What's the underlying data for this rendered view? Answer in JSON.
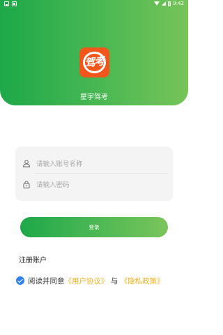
{
  "status_bar": {
    "time": "9:42"
  },
  "header": {
    "app_name": "星宇驾考",
    "logo_text": "驾考"
  },
  "form": {
    "username_placeholder": "请输入账号名称",
    "password_placeholder": "请输入密码"
  },
  "login_button": {
    "label": "登录"
  },
  "register": {
    "label": "注册账户"
  },
  "agreement": {
    "checked": true,
    "prefix": "阅读并同意",
    "user_agreement": "《用户协议》",
    "connector": "与",
    "privacy_policy": "《隐私政策》"
  },
  "colors": {
    "brand_green": "#1ea849",
    "logo_orange": "#f4551b",
    "link_yellow": "#f2b01c",
    "check_blue": "#2f80ed"
  }
}
